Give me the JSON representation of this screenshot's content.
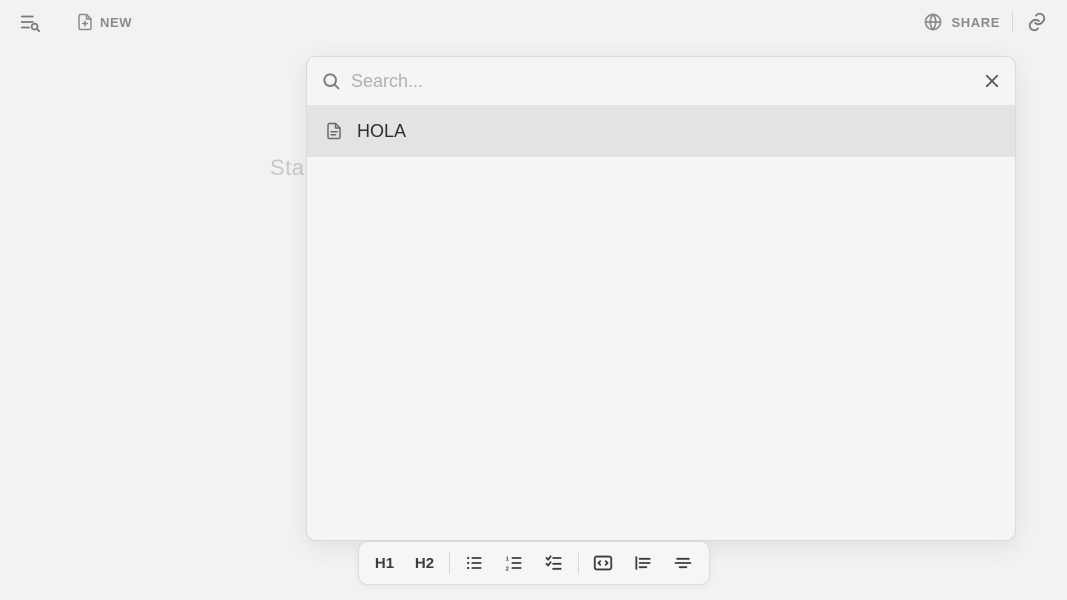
{
  "topbar": {
    "new_label": "NEW",
    "share_label": "SHARE"
  },
  "editor": {
    "placeholder_visible": "Sta"
  },
  "search_modal": {
    "placeholder": "Search...",
    "input_value": "",
    "results": [
      {
        "title": "HOLA"
      }
    ]
  },
  "format_toolbar": {
    "h1": "H1",
    "h2": "H2"
  }
}
